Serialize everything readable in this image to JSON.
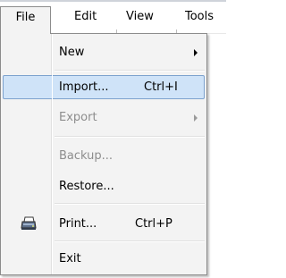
{
  "menubar": {
    "items": [
      {
        "label": "File"
      },
      {
        "label": "Edit"
      },
      {
        "label": "View"
      },
      {
        "label": "Tools"
      }
    ]
  },
  "file_menu": {
    "new": {
      "label": "New"
    },
    "import": {
      "label": "Import...",
      "shortcut": "Ctrl+I"
    },
    "export": {
      "label": "Export"
    },
    "backup": {
      "label": "Backup..."
    },
    "restore": {
      "label": "Restore..."
    },
    "print": {
      "label": "Print...",
      "shortcut": "Ctrl+P",
      "icon": "printer-icon"
    },
    "exit": {
      "label": "Exit"
    }
  },
  "colors": {
    "highlight_fill": "#cfe3f8",
    "highlight_border": "#7da2ce",
    "menu_background": "#f3f3f3",
    "disabled_text": "#8d8d8d"
  }
}
